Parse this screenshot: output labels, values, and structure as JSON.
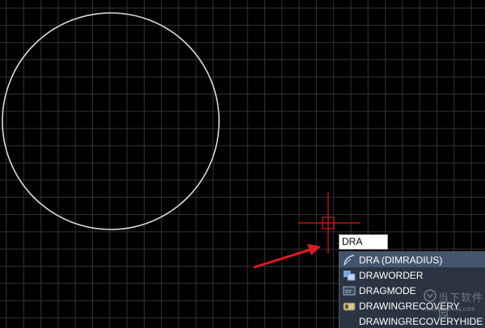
{
  "command_input": {
    "value": "DRA"
  },
  "autocomplete": {
    "items": [
      {
        "label": "DRA (DIMRADIUS)",
        "icon": "dimradius-icon"
      },
      {
        "label": "DRAWORDER",
        "icon": "draworder-icon"
      },
      {
        "label": "DRAGMODE",
        "icon": "dragmode-icon"
      },
      {
        "label": "DRAWINGRECOVERY",
        "icon": "drawingrecovery-icon"
      },
      {
        "label": "DRAWINGRECOVERYHIDE",
        "icon": "none"
      }
    ]
  },
  "watermark": {
    "text": "当下软件园",
    "url": "www.downxia.com"
  },
  "colors": {
    "background": "#000000",
    "grid": "#2f3338",
    "circle": "#d9d9d9",
    "crosshair": "#e0161a",
    "arrow": "#e01a1f",
    "highlight": "#44566e",
    "list_bg": "#2b3442"
  }
}
